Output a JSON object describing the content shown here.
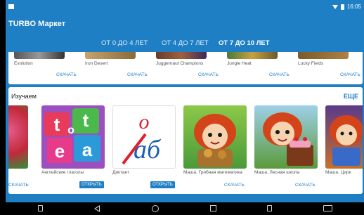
{
  "status_bar": {
    "time": "16:05"
  },
  "app": {
    "title": "TURBO Маркет"
  },
  "tabs": [
    {
      "label": "ОТ 0 ДО 4 ЛЕТ"
    },
    {
      "label": "ОТ 4 ДО 7 ЛЕТ"
    },
    {
      "label": "ОТ 7 ДО 10 ЛЕТ"
    }
  ],
  "top_row": {
    "items": [
      {
        "name": "Evolution",
        "action": "СКАЧАТЬ"
      },
      {
        "name": "Iron Desert",
        "action": "СКАЧАТЬ"
      },
      {
        "name": "Juggernaut Champions",
        "action": "СКАЧАТЬ"
      },
      {
        "name": "Jungle Heat",
        "action": "СКАЧАТЬ"
      },
      {
        "name": "Lucky Fields",
        "action": "СКАЧАТЬ"
      }
    ]
  },
  "section": {
    "title": "Изучаем",
    "more": "ЕЩЕ",
    "items": [
      {
        "name": "",
        "action": "СКАЧАТЬ",
        "action_type": "download"
      },
      {
        "name": "Английские глаголы",
        "action": "ОТКРЫТЬ",
        "action_type": "open",
        "thumb_letters": [
          "t",
          "o",
          "t",
          "e",
          "a"
        ]
      },
      {
        "name": "Диктант",
        "action": "ОТКРЫТЬ",
        "action_type": "open",
        "thumb_letters": [
          "о",
          "аб"
        ]
      },
      {
        "name": "Маша. Грибная математика",
        "action": "СКАЧАТЬ",
        "action_type": "download"
      },
      {
        "name": "Маша. Лесная школа",
        "action": "СКАЧАТЬ",
        "action_type": "download"
      },
      {
        "name": "Маша. Цирк",
        "action": "",
        "action_type": "open"
      }
    ]
  },
  "colors": {
    "primary": "#1f7fc4",
    "tab_active": "#ffffff",
    "tab_inactive": "#dce9f7"
  }
}
